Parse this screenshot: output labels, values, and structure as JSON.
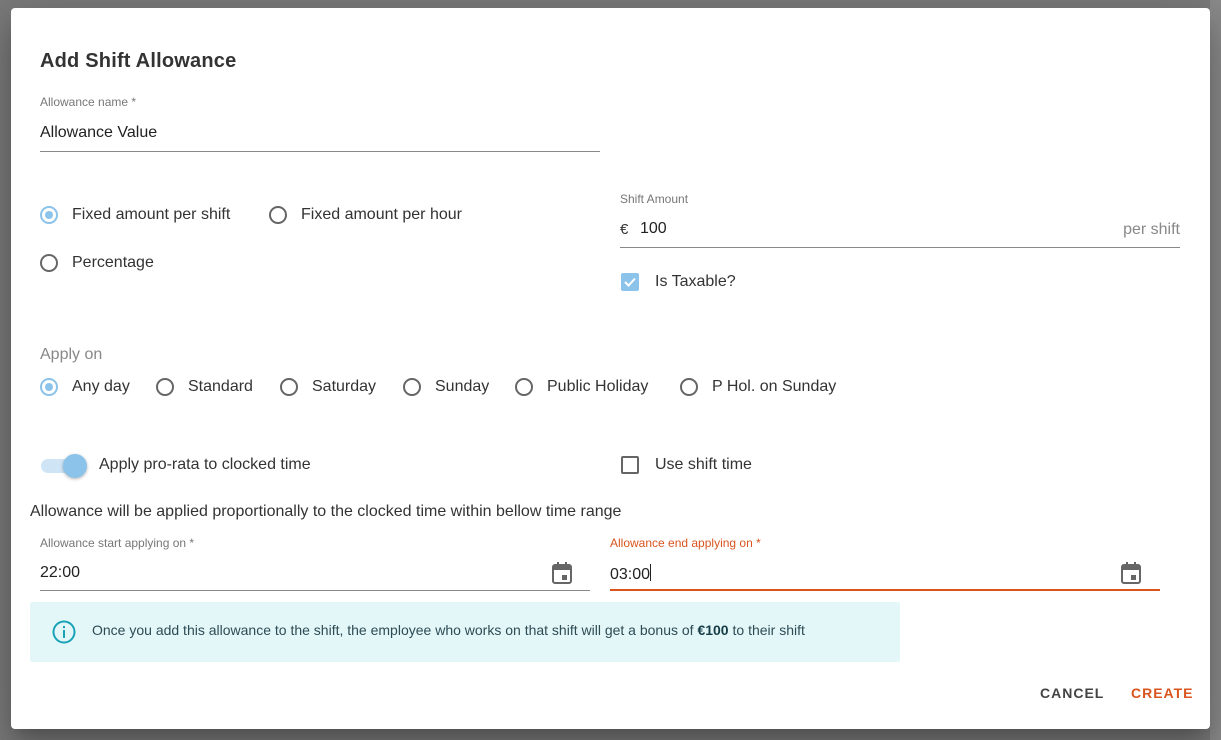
{
  "dialog": {
    "title": "Add Shift Allowance"
  },
  "allowance_name": {
    "label": "Allowance name *",
    "value": "Allowance Value"
  },
  "amount_type": {
    "options": [
      "Fixed amount per shift",
      "Fixed amount per hour",
      "Percentage"
    ],
    "selected": "Fixed amount per shift"
  },
  "shift_amount": {
    "label": "Shift Amount",
    "prefix": "€",
    "value": "100",
    "suffix": "per shift"
  },
  "is_taxable": {
    "label": "Is Taxable?",
    "checked": true
  },
  "apply_on": {
    "label": "Apply on",
    "options": [
      "Any day",
      "Standard",
      "Saturday",
      "Sunday",
      "Public Holiday",
      "P Hol. on Sunday"
    ],
    "selected": "Any day"
  },
  "pro_rata": {
    "label": "Apply pro-rata to clocked time",
    "on": true
  },
  "use_shift_time": {
    "label": "Use shift time",
    "checked": false
  },
  "range_note": "Allowance will be applied proportionally to the clocked time within bellow time range",
  "start_time": {
    "label": "Allowance start applying on *",
    "value": "22:00"
  },
  "end_time": {
    "label": "Allowance end applying on *",
    "value": "03:00"
  },
  "info": {
    "text_before": "Once you add this allowance to the shift, the employee who works on that shift will get a bonus of ",
    "amount": "€100",
    "text_after": " to their shift"
  },
  "actions": {
    "cancel": "CANCEL",
    "create": "CREATE"
  },
  "colors": {
    "accent": "#8cc3ea",
    "error": "#d9541e",
    "info_icon": "#1aa3b8",
    "info_bg": "#e4f7f8"
  },
  "icons": [
    "calendar-icon",
    "info-icon",
    "check-icon"
  ]
}
